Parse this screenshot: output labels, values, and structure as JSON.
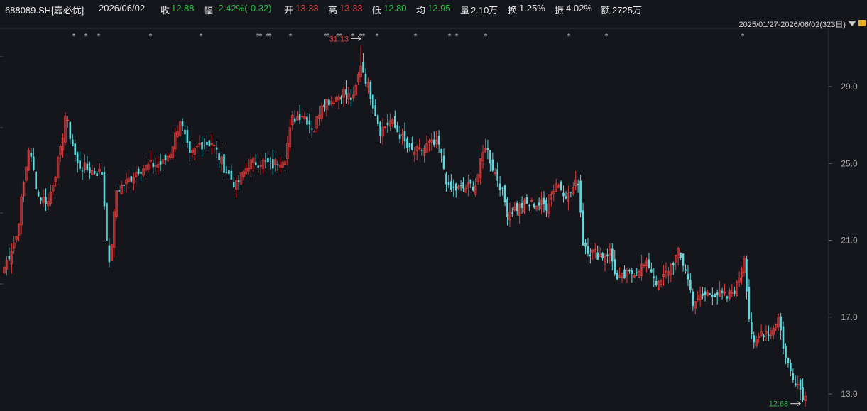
{
  "header": {
    "symbol": "688089.SH[嘉必优]",
    "date": "2026/06/02",
    "close_label": "收",
    "close_value": "12.88",
    "change_label": "幅",
    "change_value": "-2.42%(-0.32)",
    "open_label": "开",
    "open_value": "13.33",
    "high_label": "高",
    "high_value": "13.33",
    "low_label": "低",
    "low_value": "12.80",
    "avg_label": "均",
    "avg_value": "12.95",
    "volume_label": "量",
    "volume_value": "2.10万",
    "turnover_label": "换",
    "turnover_value": "1.25%",
    "amplitude_label": "振",
    "amplitude_value": "4.02%",
    "amount_label": "额",
    "amount_value": "2725万",
    "range_label": "2025/01/27-2026/06/02(323日)",
    "menu_icon": "triangle-down-icon",
    "side_icon": "lock-icon"
  },
  "colors": {
    "background": "#14161c",
    "up": "#e03a3a",
    "down": "#5fd9de",
    "grid": "#2a2d36",
    "axis_text": "#a9a9a9",
    "white_text": "#e8e8e8",
    "green_text": "#2fc04a",
    "red_text": "#e63c3c"
  },
  "chart_data": {
    "type": "candlestick",
    "x_range": [
      "2025/01/27",
      "2026/06/02"
    ],
    "trading_days": 323,
    "ylim": [
      12.2,
      32.2
    ],
    "y_ticks": [
      "29.0",
      "25.0",
      "21.0",
      "17.0",
      "13.0"
    ],
    "y_tick_values": [
      29,
      25,
      21,
      17,
      13
    ],
    "max_marker": "31.13",
    "max_value": 31.13,
    "min_marker": "12.68",
    "min_value": 12.68,
    "star_symbol": "*",
    "approx_price_path": [
      [
        0,
        19.6
      ],
      [
        5,
        21.2
      ],
      [
        10,
        25.8
      ],
      [
        14,
        23.3
      ],
      [
        18,
        23.0
      ],
      [
        23,
        25.6
      ],
      [
        25,
        27.5
      ],
      [
        30,
        24.9
      ],
      [
        36,
        24.6
      ],
      [
        40,
        24.5
      ],
      [
        43,
        19.6
      ],
      [
        46,
        23.6
      ],
      [
        50,
        24.0
      ],
      [
        55,
        24.7
      ],
      [
        60,
        24.9
      ],
      [
        65,
        25.0
      ],
      [
        68,
        25.6
      ],
      [
        72,
        27.3
      ],
      [
        76,
        25.3
      ],
      [
        80,
        26.0
      ],
      [
        85,
        26.1
      ],
      [
        90,
        24.8
      ],
      [
        95,
        23.8
      ],
      [
        100,
        25.0
      ],
      [
        105,
        25.1
      ],
      [
        110,
        24.9
      ],
      [
        115,
        25.4
      ],
      [
        118,
        27.3
      ],
      [
        122,
        27.6
      ],
      [
        127,
        26.8
      ],
      [
        130,
        28.2
      ],
      [
        134,
        28.3
      ],
      [
        139,
        28.7
      ],
      [
        143,
        28.3
      ],
      [
        146,
        30.2
      ],
      [
        150,
        28.6
      ],
      [
        154,
        26.7
      ],
      [
        158,
        27.2
      ],
      [
        162,
        26.5
      ],
      [
        166,
        25.6
      ],
      [
        170,
        25.6
      ],
      [
        174,
        26.0
      ],
      [
        178,
        25.9
      ],
      [
        182,
        23.6
      ],
      [
        188,
        23.7
      ],
      [
        193,
        23.9
      ],
      [
        197,
        26.0
      ],
      [
        200,
        24.8
      ],
      [
        203,
        23.9
      ],
      [
        206,
        22.5
      ],
      [
        212,
        22.8
      ],
      [
        217,
        22.9
      ],
      [
        222,
        22.8
      ],
      [
        226,
        24.0
      ],
      [
        231,
        23.3
      ],
      [
        235,
        24.1
      ],
      [
        237,
        20.9
      ],
      [
        240,
        20.4
      ],
      [
        245,
        20.2
      ],
      [
        248,
        20.4
      ],
      [
        251,
        18.9
      ],
      [
        256,
        19.2
      ],
      [
        260,
        19.6
      ],
      [
        264,
        19.7
      ],
      [
        268,
        18.6
      ],
      [
        272,
        19.5
      ],
      [
        276,
        20.3
      ],
      [
        279,
        19.5
      ],
      [
        282,
        17.8
      ],
      [
        286,
        18.1
      ],
      [
        290,
        18.3
      ],
      [
        296,
        18.0
      ],
      [
        300,
        18.6
      ],
      [
        303,
        20.2
      ],
      [
        305,
        17.0
      ],
      [
        307,
        15.4
      ],
      [
        310,
        16.2
      ],
      [
        314,
        16.3
      ],
      [
        317,
        17.0
      ],
      [
        320,
        14.8
      ],
      [
        322,
        14.2
      ],
      [
        325,
        13.5
      ],
      [
        327,
        13.0
      ],
      [
        328,
        12.9
      ]
    ]
  }
}
